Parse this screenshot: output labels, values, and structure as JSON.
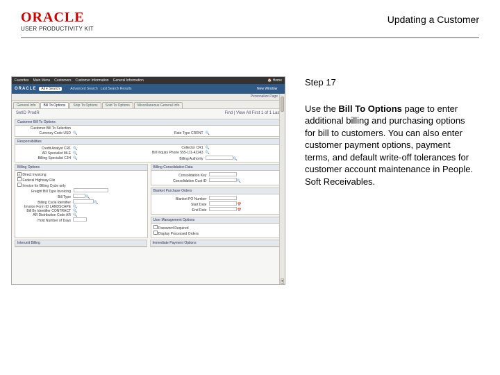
{
  "header": {
    "brand": "ORACLE",
    "product": "USER PRODUCTIVITY KIT",
    "title": "Updating a Customer"
  },
  "instructions": {
    "step_label": "Step 17",
    "body_pre": "Use the ",
    "body_bold": "Bill To Options",
    "body_post": " page to enter additional billing and purchasing options for bill to customers. You can also enter customer payment options, payment terms, and default write-off tolerances for customer account maintenance in People. Soft Receivables."
  },
  "app": {
    "nav_items": [
      "Favorites",
      "Main Menu",
      "Customers",
      "Customer Information",
      "General Information"
    ],
    "home_label": "Home",
    "brand": "ORACLE",
    "gopill": "All ▾   Search",
    "adv_search": "Advanced Search",
    "last_results": "Last Search Results",
    "new_window": "New Window",
    "footer_links": "Personalize Page",
    "tabs": [
      "General Info",
      "Bill To Options",
      "Ship To Options",
      "Sold To Options",
      "Miscellaneous General Info"
    ],
    "breadcrumb": "SetID  ProdR",
    "find_nav": "Find | View All    First  1 of 1  Last",
    "sections": {
      "customer_opts": "Customer Bill To Options",
      "responsibilities": "Responsibilities",
      "billing_options": "Billing Options",
      "billing_cons": "Billing Consolidation Data",
      "blanket_po": "Blanket Purchase Orders",
      "interunit": "Interunit Billing",
      "user_options": "User Management Options",
      "immediate_options": "Immediate Payment Options"
    },
    "fields": {
      "since_date": "Customer Bill To Selection",
      "currency_code": "Currency Code  USD",
      "rate_type": "Rate Type  CRRNT",
      "credit_analyst": "Credit Analyst  CR1",
      "collector": "Collector  CR1",
      "ar_specialist": "AR Specialist  MLE",
      "billing_specialist": "Billing Specialist  CJH",
      "bill_inquiry": "Bill Inquiry Phone  555-111-42243",
      "billing_authority": "Billing Authority",
      "direct_invoicing": "Direct Invoicing",
      "fed_hwy": "Federal Highway File",
      "billing_cycle": "Invoice for Billing Cycle only",
      "freight_bill": "Freight Bill Type  Invoicing",
      "bill_type": "Bill Type",
      "cycle_ident": "Billing Cycle Identifier",
      "invoice_form": "Invoice Form ID  LANDSCAPE",
      "bill_by": "Bill By Identifier  CONTRACT",
      "ar_dist": "AR Distribution Code AR",
      "hold_days": "Hold Number of Days",
      "cons_key": "Consolidation Key",
      "cons_cust": "Consolidation Cust ID",
      "po_start": "Start Date",
      "po_end": "End Date",
      "po_num": "Blanket PO Number",
      "password_req": "Password Required",
      "display_processed": "Display Processed Orders"
    }
  }
}
